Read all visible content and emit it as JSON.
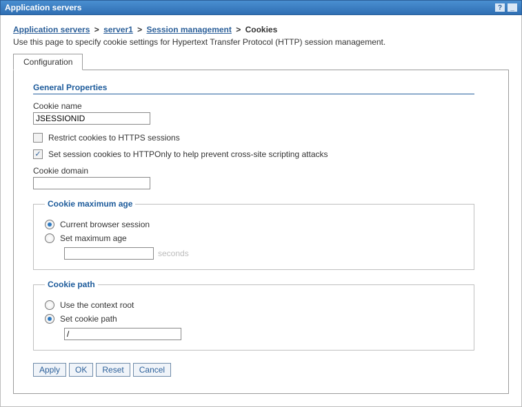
{
  "titlebar": {
    "title": "Application servers"
  },
  "breadcrumb": {
    "items": [
      {
        "label": "Application servers"
      },
      {
        "label": "server1"
      },
      {
        "label": "Session management"
      }
    ],
    "current": "Cookies",
    "sep": ">"
  },
  "description": "Use this page to specify cookie settings for Hypertext Transfer Protocol (HTTP) session management.",
  "tabs": {
    "configuration": "Configuration"
  },
  "general": {
    "heading": "General Properties",
    "cookie_name_label": "Cookie name",
    "cookie_name_value": "JSESSIONID",
    "restrict_https_label": "Restrict cookies to HTTPS sessions",
    "restrict_https_checked": false,
    "httponly_label": "Set session cookies to HTTPOnly to help prevent cross-site scripting attacks",
    "httponly_checked": true,
    "cookie_domain_label": "Cookie domain",
    "cookie_domain_value": ""
  },
  "maxage": {
    "legend": "Cookie maximum age",
    "current_session_label": "Current browser session",
    "set_max_label": "Set maximum age",
    "selected": "current",
    "seconds_value": "",
    "seconds_unit": "seconds"
  },
  "cookiepath": {
    "legend": "Cookie path",
    "use_context_label": "Use the context root",
    "set_path_label": "Set cookie path",
    "selected": "set",
    "path_value": "/"
  },
  "buttons": {
    "apply": "Apply",
    "ok": "OK",
    "reset": "Reset",
    "cancel": "Cancel"
  }
}
